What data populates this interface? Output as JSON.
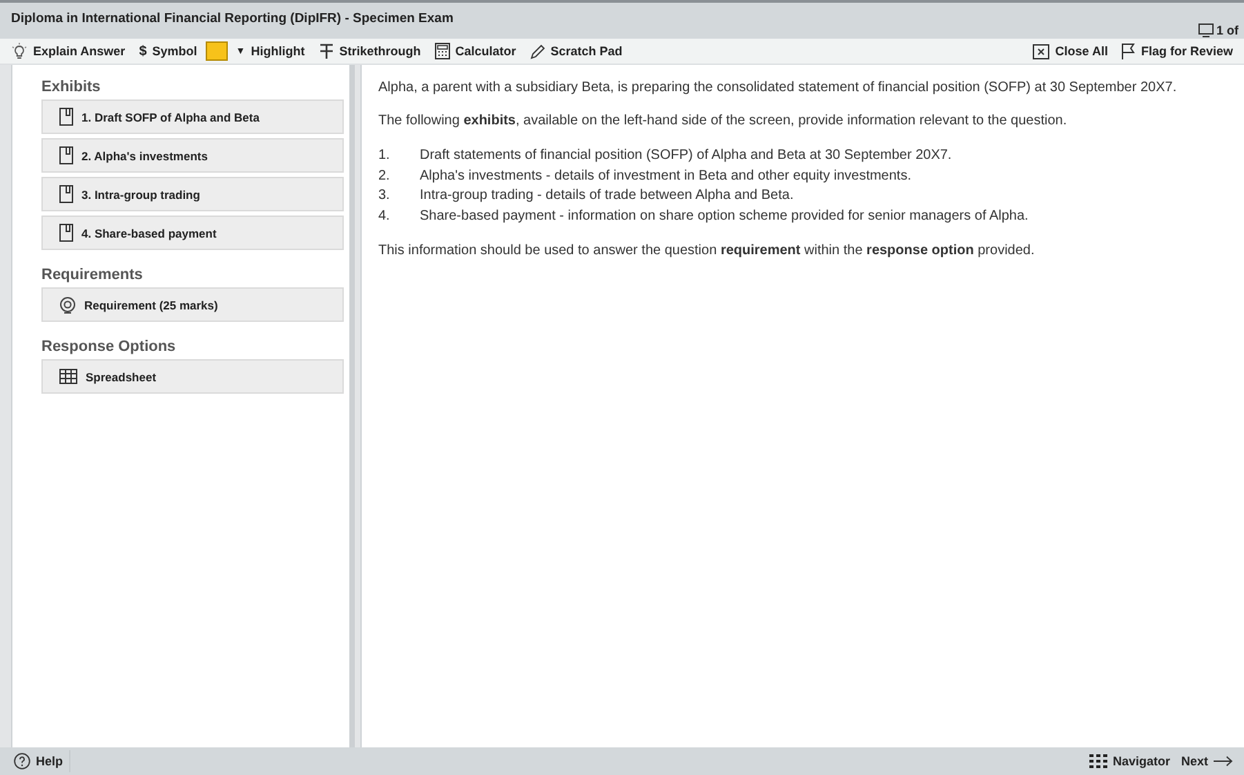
{
  "window": {
    "title": "Diploma in International Financial Reporting (DipIFR) - Specimen Exam",
    "counter": "1 of"
  },
  "toolbar": {
    "left": [
      {
        "kind": "bulb",
        "label": "Explain Answer"
      },
      {
        "kind": "symbol",
        "glyph": "$",
        "label": "Symbol"
      },
      {
        "kind": "highlight",
        "caret": "▼",
        "label": "Highlight"
      },
      {
        "kind": "strike",
        "label": "Strikethrough"
      },
      {
        "kind": "calculator",
        "label": "Calculator"
      },
      {
        "kind": "pencil",
        "label": "Scratch Pad"
      }
    ],
    "right": [
      {
        "kind": "close",
        "label": "Close All"
      },
      {
        "kind": "flag",
        "label": "Flag for Review"
      }
    ]
  },
  "sidebar": {
    "sections": [
      {
        "heading": "Exhibits",
        "items": [
          {
            "kind": "exhibit",
            "label": "1. Draft SOFP of Alpha and Beta"
          },
          {
            "kind": "exhibit",
            "label": "2. Alpha's investments"
          },
          {
            "kind": "exhibit",
            "label": "3. Intra-group trading"
          },
          {
            "kind": "exhibit",
            "label": "4. Share-based payment"
          }
        ]
      },
      {
        "heading": "Requirements",
        "items": [
          {
            "kind": "requirement",
            "label": "Requirement (25 marks)"
          }
        ]
      },
      {
        "heading": "Response Options",
        "items": [
          {
            "kind": "spreadsheet",
            "label": "Spreadsheet"
          }
        ]
      }
    ]
  },
  "content": {
    "intro": "Alpha, a parent with a subsidiary Beta, is preparing the consolidated statement of financial position (SOFP) at 30 September 20X7.",
    "lead": "The following **exhibits**, available on the left-hand side of the screen, provide information relevant to the question.",
    "list": [
      {
        "number": "1.",
        "text": "Draft statements of financial position (SOFP) of Alpha and Beta at 30 September 20X7."
      },
      {
        "number": "2.",
        "text": "Alpha's investments - details of investment in Beta and other equity investments."
      },
      {
        "number": "3.",
        "text": "Intra-group trading - details of trade between Alpha and Beta."
      },
      {
        "number": "4.",
        "text": "Share-based payment - information on share option scheme provided for senior managers of Alpha."
      }
    ],
    "closing": "This information should be used to answer the question **requirement** within the **response option** provided."
  },
  "footer": {
    "help": "Help",
    "navigator": "Navigator",
    "next": "Next"
  }
}
